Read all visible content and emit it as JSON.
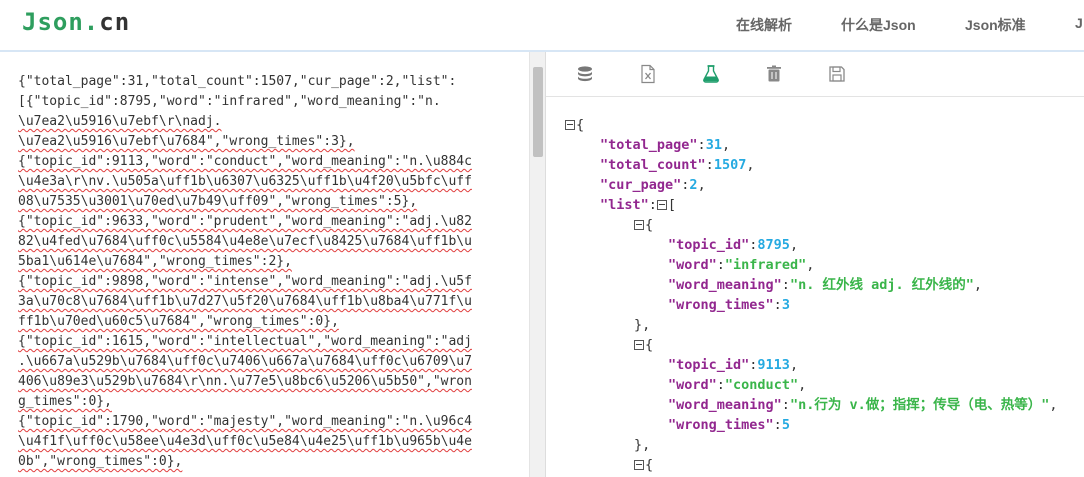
{
  "header": {
    "logo_part1": "Json",
    "logo_part2": ".",
    "logo_part3": "cn",
    "nav": [
      "在线解析",
      "什么是Json",
      "Json标准",
      "J"
    ]
  },
  "raw_lines": [
    "{\"total_page\":31,\"total_count\":1507,\"cur_page\":2,\"list\":",
    "[{\"topic_id\":8795,\"word\":\"infrared\",\"word_meaning\":\"n.",
    "\\u7ea2\\u5916\\u7ebf\\r\\nadj.",
    "\\u7ea2\\u5916\\u7ebf\\u7684\",\"wrong_times\":3},",
    "{\"topic_id\":9113,\"word\":\"conduct\",\"word_meaning\":\"n.\\u884c",
    "\\u4e3a\\r\\nv.\\u505a\\uff1b\\u6307\\u6325\\uff1b\\u4f20\\u5bfc\\uff",
    "08\\u7535\\u3001\\u70ed\\u7b49\\uff09\",\"wrong_times\":5},",
    "{\"topic_id\":9633,\"word\":\"prudent\",\"word_meaning\":\"adj.\\u82",
    "82\\u4fed\\u7684\\uff0c\\u5584\\u4e8e\\u7ecf\\u8425\\u7684\\uff1b\\u",
    "5ba1\\u614e\\u7684\",\"wrong_times\":2},",
    "{\"topic_id\":9898,\"word\":\"intense\",\"word_meaning\":\"adj.\\u5f",
    "3a\\u70c8\\u7684\\uff1b\\u7d27\\u5f20\\u7684\\uff1b\\u8ba4\\u771f\\u",
    "ff1b\\u70ed\\u60c5\\u7684\",\"wrong_times\":0},",
    "{\"topic_id\":1615,\"word\":\"intellectual\",\"word_meaning\":\"adj",
    ".\\u667a\\u529b\\u7684\\uff0c\\u7406\\u667a\\u7684\\uff0c\\u6709\\u7",
    "406\\u89e3\\u529b\\u7684\\r\\nn.\\u77e5\\u8bc6\\u5206\\u5b50\",\"wron",
    "g_times\":0},",
    "{\"topic_id\":1790,\"word\":\"majesty\",\"word_meaning\":\"n.\\u96c4",
    "\\u4f1f\\uff0c\\u58ee\\u4e3d\\uff0c\\u5e84\\u4e25\\uff1b\\u965b\\u4e",
    "0b\",\"wrong_times\":0},"
  ],
  "toolbar": [
    "database-icon",
    "excel-file-icon",
    "flask-icon",
    "trash-icon",
    "save-icon"
  ],
  "tree": {
    "keys": {
      "total_page": "\"total_page\"",
      "total_count": "\"total_count\"",
      "cur_page": "\"cur_page\"",
      "list": "\"list\"",
      "topic_id": "\"topic_id\"",
      "word": "\"word\"",
      "word_meaning": "\"word_meaning\"",
      "wrong_times": "\"wrong_times\""
    },
    "total_page": "31",
    "total_count": "1507",
    "cur_page": "2",
    "items": [
      {
        "topic_id": "8795",
        "word": "\"infrared\"",
        "word_meaning": "\"n. 红外线 adj. 红外线的\"",
        "wrong_times": "3"
      },
      {
        "topic_id": "9113",
        "word": "\"conduct\"",
        "word_meaning": "\"n.行为 v.做；指挥；传导（电、热等）\"",
        "wrong_times": "5"
      }
    ]
  },
  "colors": {
    "key": "#92278f",
    "number": "#25aae1",
    "string": "#3ab54a",
    "logo": "#2e9e5e"
  }
}
